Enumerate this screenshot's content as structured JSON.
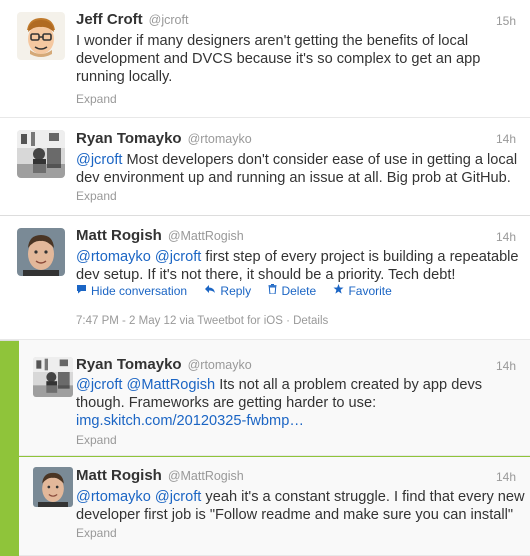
{
  "tweets": [
    {
      "name": "Jeff Croft",
      "handle": "@jcroft",
      "time": "15h",
      "lines": [
        [
          {
            "t": "I wonder if many designers aren't getting the benefits of local"
          }
        ],
        [
          {
            "t": "development and DVCS because it's so complex to get an app"
          }
        ],
        [
          {
            "t": "running locally."
          }
        ]
      ],
      "expand": "Expand"
    },
    {
      "name": "Ryan Tomayko",
      "handle": "@rtomayko",
      "time": "14h",
      "lines": [
        [
          {
            "m": "@jcroft"
          },
          {
            "t": " Most developers don't consider ease of use in getting a local"
          }
        ],
        [
          {
            "t": "dev environment up and running an issue at all. Big prob at GitHub."
          }
        ]
      ],
      "expand": "Expand"
    },
    {
      "name": "Matt Rogish",
      "handle": "@MattRogish",
      "time": "14h",
      "lines": [
        [
          {
            "m": "@rtomayko"
          },
          {
            "t": " "
          },
          {
            "m": "@jcroft"
          },
          {
            "t": " first step of every project is building a repeatable"
          }
        ],
        [
          {
            "t": "dev setup. If it's not there, it should be a priority. Tech debt!"
          }
        ]
      ],
      "actions": {
        "hide": "Hide conversation",
        "reply": "Reply",
        "delete": "Delete",
        "favorite": "Favorite"
      },
      "meta": "7:47 PM - 2 May 12 via Tweetbot for iOS · Details"
    },
    {
      "name": "Ryan Tomayko",
      "handle": "@rtomayko",
      "time": "14h",
      "lines": [
        [
          {
            "m": "@jcroft"
          },
          {
            "t": " "
          },
          {
            "m": "@MattRogish"
          },
          {
            "t": " Its not all a problem created by app devs"
          }
        ],
        [
          {
            "t": "though. Frameworks are getting harder to use:"
          }
        ],
        [
          {
            "m": "img.skitch.com/20120325-fwbmp…"
          }
        ]
      ],
      "expand": "Expand"
    },
    {
      "name": "Matt Rogish",
      "handle": "@MattRogish",
      "time": "14h",
      "lines": [
        [
          {
            "m": "@rtomayko"
          },
          {
            "t": " "
          },
          {
            "m": "@jcroft"
          },
          {
            "t": " yeah it's a constant struggle. I find that every new"
          }
        ],
        [
          {
            "t": "developer first job is \"Follow readme and make sure you can install\""
          }
        ]
      ],
      "expand": "Expand"
    }
  ],
  "icons": {
    "hide": "speech-bubble-icon",
    "reply": "reply-arrow-icon",
    "delete": "trash-icon",
    "favorite": "star-icon"
  },
  "colors": {
    "background": "#8fc43a",
    "link": "#1b65c4",
    "muted": "#999999"
  }
}
